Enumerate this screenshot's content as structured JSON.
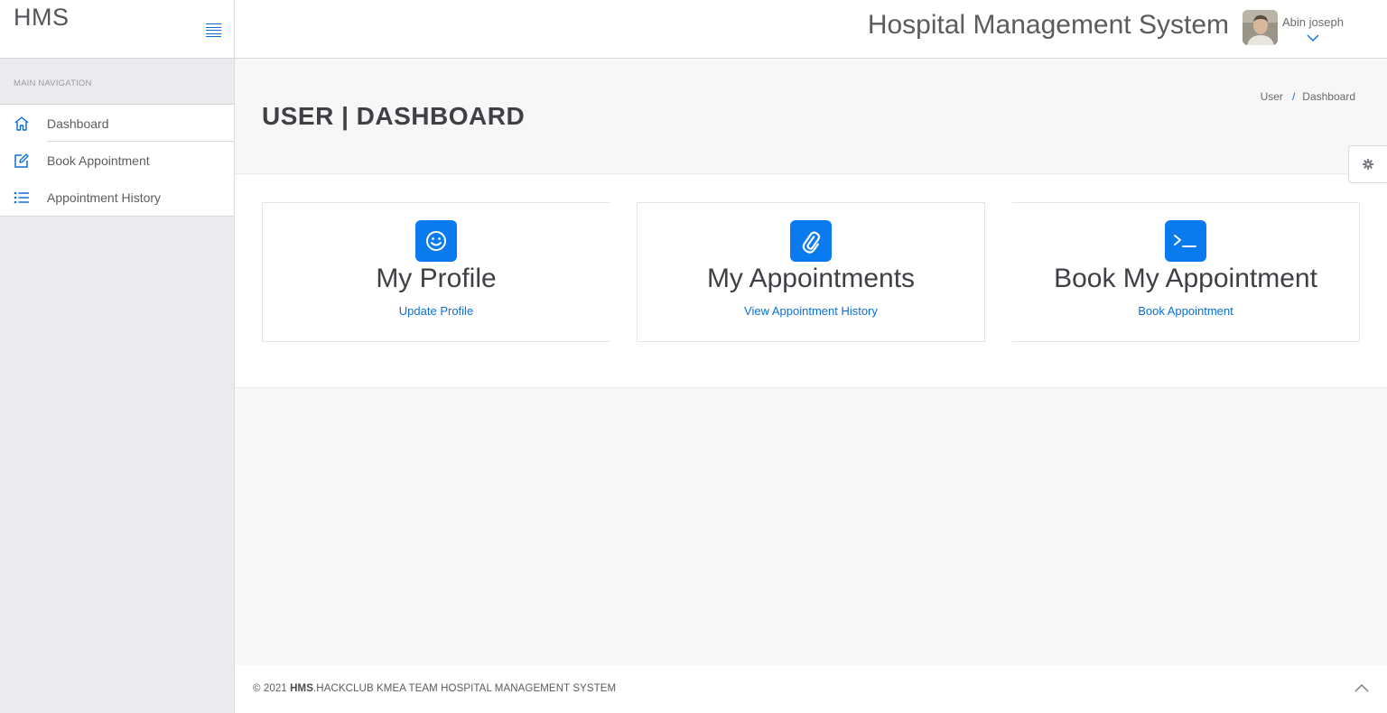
{
  "brand": {
    "name": "HMS"
  },
  "header": {
    "title": "Hospital Management System",
    "user_name": "Abin joseph"
  },
  "sidebar": {
    "heading": "MAIN NAVIGATION",
    "items": [
      {
        "label": "Dashboard",
        "icon": "home-icon"
      },
      {
        "label": "Book Appointment",
        "icon": "edit-icon"
      },
      {
        "label": "Appointment History",
        "icon": "list-icon"
      }
    ]
  },
  "page": {
    "title": "USER | DASHBOARD",
    "breadcrumb": [
      "User",
      "Dashboard"
    ]
  },
  "cards": [
    {
      "title": "My Profile",
      "link": "Update Profile",
      "icon": "smiley-icon"
    },
    {
      "title": "My Appointments",
      "link": "View Appointment History",
      "icon": "paperclip-icon"
    },
    {
      "title": "Book My Appointment",
      "link": "Book Appointment",
      "icon": "terminal-icon"
    }
  ],
  "footer": {
    "prefix": "© 2021 ",
    "brand": "HMS",
    "suffix": ".HACKCLUB KMEA TEAM HOSPITAL MANAGEMENT SYSTEM"
  },
  "colors": {
    "accent": "#0a7bef",
    "link": "#0a6fd8",
    "sidebar_bg": "#ebebef"
  }
}
